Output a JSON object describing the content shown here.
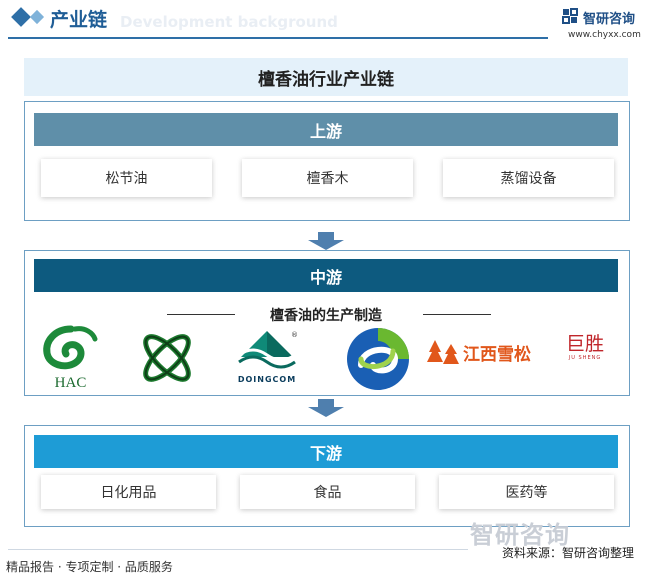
{
  "header": {
    "title": "产业链",
    "subtitle_watermark": "Development background",
    "brand_name": "智研咨询",
    "brand_url": "www.chyxx.com"
  },
  "diagram": {
    "title": "檀香油行业产业链",
    "upstream": {
      "label": "上游",
      "items": [
        "松节油",
        "檀香木",
        "蒸馏设备"
      ]
    },
    "midstream": {
      "label": "中游",
      "heading": "檀香油的生产制造",
      "logos": [
        {
          "text": "HAC",
          "icon": "hac-logo"
        },
        {
          "text": "",
          "icon": "green-knot-logo"
        },
        {
          "text": "DOINGCOM",
          "icon": "doingcom-logo"
        },
        {
          "text": "",
          "icon": "blue-green-swirl-logo"
        },
        {
          "text": "江西雪松",
          "icon": "jiangxi-xuesong-logo"
        },
        {
          "text": "巨胜",
          "subtext": "JU SHENG",
          "icon": "jusheng-logo"
        }
      ]
    },
    "downstream": {
      "label": "下游",
      "items": [
        "日化用品",
        "食品",
        "医药等"
      ]
    }
  },
  "footer": {
    "left": "精品报告 · 专项定制 · 品质服务",
    "source": "资料来源：智研咨询整理",
    "watermark": "智研咨询"
  },
  "colors": {
    "upstream_bar": "#5f8fa9",
    "midstream_bar": "#0d5a7f",
    "downstream_bar": "#1e9cd6",
    "title_bg": "#e4f1fa",
    "accent": "#2e6fa7"
  }
}
